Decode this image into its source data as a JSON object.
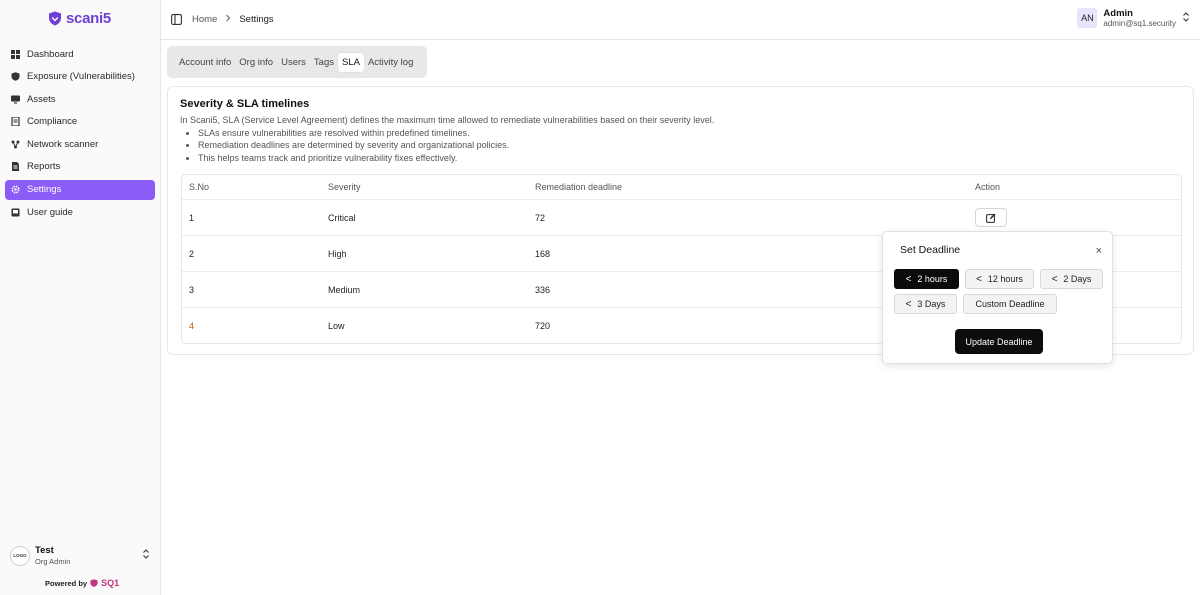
{
  "brand": {
    "name": "scani5",
    "powered_by": "Powered by",
    "powered_brand": "SQ1",
    "accent": "#8b5cf6"
  },
  "sidebar": {
    "items": [
      {
        "label": "Dashboard",
        "icon": "dashboard-icon"
      },
      {
        "label": "Exposure (Vulnerabilities)",
        "icon": "shield-icon"
      },
      {
        "label": "Assets",
        "icon": "monitor-icon"
      },
      {
        "label": "Compliance",
        "icon": "document-icon"
      },
      {
        "label": "Network scanner",
        "icon": "network-icon"
      },
      {
        "label": "Reports",
        "icon": "report-icon"
      },
      {
        "label": "Settings",
        "icon": "gear-icon",
        "active": true
      },
      {
        "label": "User guide",
        "icon": "book-icon"
      }
    ],
    "org": {
      "name": "Test",
      "role": "Org Admin",
      "logo_text": "LOGO"
    }
  },
  "header": {
    "breadcrumb": [
      "Home",
      "Settings"
    ],
    "user": {
      "initials": "AN",
      "name": "Admin",
      "email": "admin@sq1.security"
    }
  },
  "tabs": [
    "Account info",
    "Org info",
    "Users",
    "Tags",
    "SLA",
    "Activity log"
  ],
  "active_tab": "SLA",
  "sla": {
    "title": "Severity & SLA timelines",
    "intro": "In Scani5, SLA (Service Level Agreement) defines the maximum time allowed to remediate vulnerabilities based on their severity level.",
    "bullets": [
      "SLAs ensure vulnerabilities are resolved within predefined timelines.",
      "Remediation deadlines are determined by severity and organizational policies.",
      "This helps teams track and prioritize vulnerability fixes effectively."
    ],
    "columns": [
      "S.No",
      "Severity",
      "Remediation deadline",
      "Action"
    ],
    "rows": [
      {
        "sno": "1",
        "severity": "Critical",
        "deadline": "72"
      },
      {
        "sno": "2",
        "severity": "High",
        "deadline": "168"
      },
      {
        "sno": "3",
        "severity": "Medium",
        "deadline": "336"
      },
      {
        "sno": "4",
        "severity": "Low",
        "deadline": "720"
      }
    ]
  },
  "popover": {
    "title": "Set Deadline",
    "close": "×",
    "lt": "<",
    "options": [
      "2 hours",
      "12 hours",
      "2 Days",
      "3 Days"
    ],
    "custom": "Custom Deadline",
    "selected": "2 hours",
    "submit": "Update Deadline"
  }
}
